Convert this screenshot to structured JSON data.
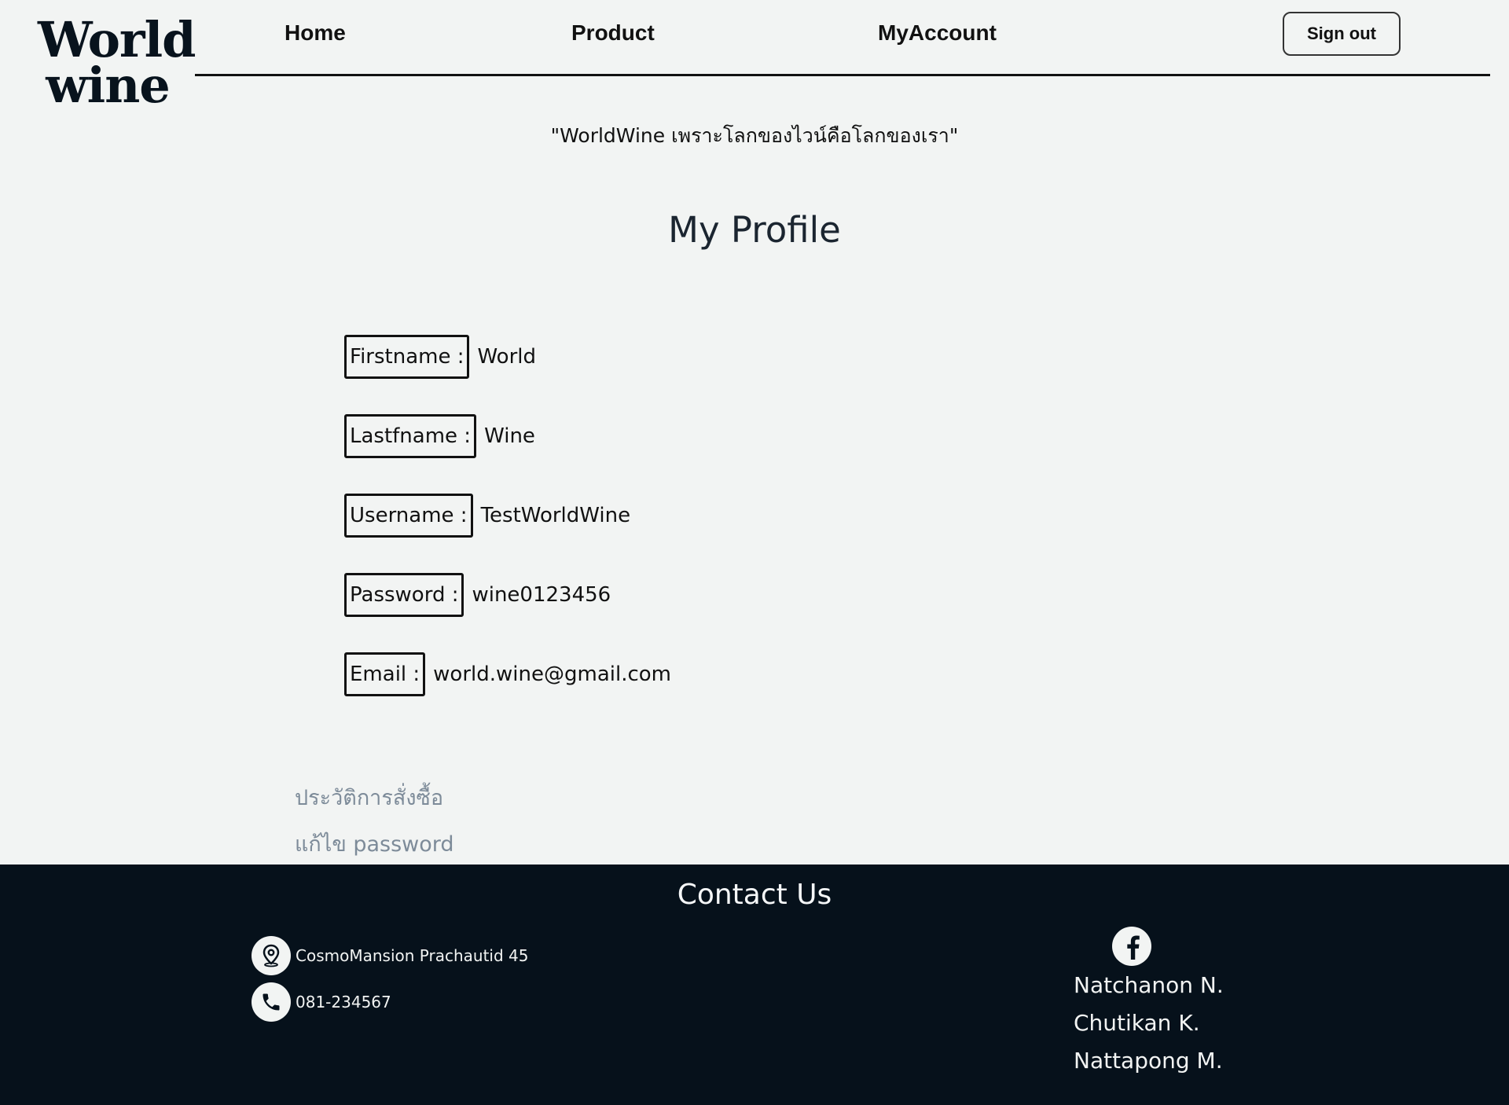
{
  "logo": {
    "line1": "World",
    "line2": "wine"
  },
  "nav": {
    "home": "Home",
    "product": "Product",
    "account": "MyAccount",
    "signout": "Sign out"
  },
  "slogan": "\"WorldWine เพราะโลกของไวน์คือโลกของเรา\"",
  "page_title": "My Profile",
  "profile": [
    {
      "label": "Firstname :",
      "value": "World"
    },
    {
      "label": "Lastfname :",
      "value": "Wine"
    },
    {
      "label": "Username :",
      "value": "TestWorldWine"
    },
    {
      "label": "Password :",
      "value": "wine0123456"
    },
    {
      "label": "Email :",
      "value": "world.wine@gmail.com"
    }
  ],
  "links": {
    "history": "ประวัติการสั่งซื้อ",
    "edit_password": "แก้ไข password"
  },
  "footer": {
    "title": "Contact Us",
    "address": "CosmoMansion Prachautid 45",
    "phone": "081-234567",
    "members": [
      "Natchanon N.",
      "Chutikan K.",
      "Nattapong M."
    ]
  },
  "icons": {
    "address": "location-pin-icon",
    "phone": "phone-icon",
    "social": "facebook-icon"
  },
  "colors": {
    "background": "#f2f4f3",
    "footer": "#06111b",
    "muted_link": "#7d8b99",
    "text": "#111111"
  }
}
